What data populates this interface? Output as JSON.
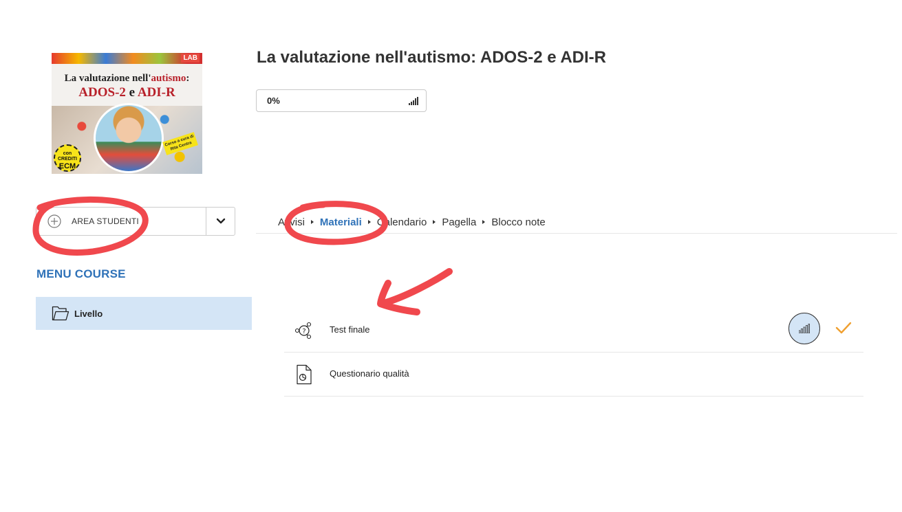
{
  "course": {
    "title": "La valutazione nell'autismo: ADOS-2 e ADI-R",
    "progress_text": "0%",
    "progress_fraction": 0.0
  },
  "cover": {
    "brand": "LAB",
    "line1_prefix": "La valutazione nell'",
    "line1_accent": "autismo",
    "line1_suffix": ":",
    "line2_a": "ADOS-2",
    "line2_mid": " e ",
    "line2_b": "ADI-R",
    "badge_top": "con",
    "badge_mid": "CREDITI",
    "badge_big": "ECM",
    "tag_line1": "Corso a cura di",
    "tag_line2": "Rita Centra"
  },
  "area_studenti": {
    "label": "AREA STUDENTI"
  },
  "menu": {
    "title": "MENU COURSE",
    "items": [
      {
        "label": "Livello"
      }
    ]
  },
  "tabs": [
    {
      "label": "Avvisi",
      "active": false
    },
    {
      "label": "Materiali",
      "active": true
    },
    {
      "label": "Calendario",
      "active": false
    },
    {
      "label": "Pagella",
      "active": false
    },
    {
      "label": "Blocco note",
      "active": false
    }
  ],
  "materials": [
    {
      "label": "Test finale",
      "icon": "quiz-icon",
      "completed": true
    },
    {
      "label": "Questionario qualità",
      "icon": "survey-document-icon",
      "completed": false
    }
  ],
  "colors": {
    "accent": "#2f72b8",
    "menu_active_bg": "#d4e5f6",
    "check": "#f0a030",
    "annotation": "#f0484d"
  }
}
